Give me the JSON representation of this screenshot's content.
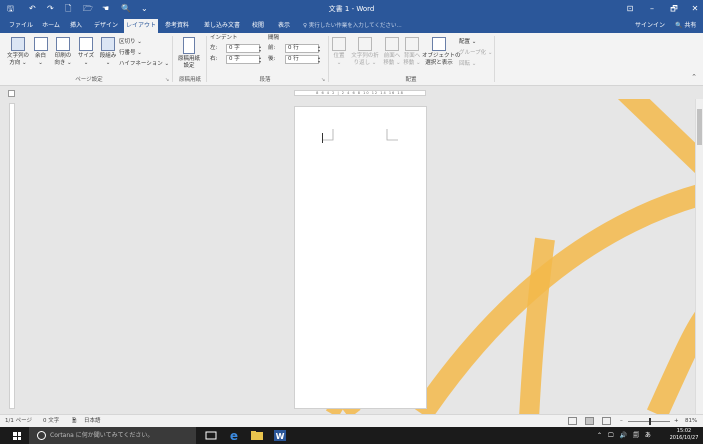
{
  "window": {
    "title": "文書 1 - Word",
    "controls": {
      "ribbon_options": "⊡",
      "minimize": "–",
      "maximize": "🗗",
      "close": "✕"
    }
  },
  "quick_access": {
    "save": "🖫",
    "undo": "↶",
    "redo": "↷",
    "new": "🗋",
    "open": "🗁",
    "touch": "☚",
    "print_preview": "🔍",
    "customize": "⌄"
  },
  "tabs": [
    {
      "label": "ファイル"
    },
    {
      "label": "ホーム"
    },
    {
      "label": "挿入"
    },
    {
      "label": "デザイン"
    },
    {
      "label": "レイアウト",
      "active": true
    },
    {
      "label": "参考資料"
    },
    {
      "label": "差し込み文書"
    },
    {
      "label": "校閲"
    },
    {
      "label": "表示"
    }
  ],
  "tell_me": "♀ 実行したい作業を入力してください...",
  "account": {
    "signin": "サインイン",
    "share": "🔍 共有"
  },
  "ribbon": {
    "page_setup": {
      "label": "ページ設定",
      "text_direction": "文字列の\n方向 ⌄",
      "margins": "余白\n⌄",
      "orientation": "印刷の\n向き ⌄",
      "size": "サイズ\n⌄",
      "columns": "段組み\n⌄",
      "breaks": "区切り ⌄",
      "line_numbers": "行番号 ⌄",
      "hyphenation": "ハイフネーション ⌄"
    },
    "genko": {
      "label": "原稿用紙",
      "button": "原稿用紙\n設定"
    },
    "paragraph": {
      "label": "段落",
      "indent_title": "インデント",
      "spacing_title": "間隔",
      "indent_left_label": "左:",
      "indent_left_value": "0 字",
      "indent_right_label": "右:",
      "indent_right_value": "0 字",
      "space_before_label": "前:",
      "space_before_value": "0 行",
      "space_after_label": "後:",
      "space_after_value": "0 行"
    },
    "arrange": {
      "label": "配置",
      "position": "位置\n⌄",
      "wrap_text": "文字列の折\nり返し ⌄",
      "bring_forward": "前面へ\n移動 ⌄",
      "send_backward": "背面へ\n移動 ⌄",
      "selection_pane": "オブジェクトの\n選択と表示",
      "align": "配置 ⌄",
      "group": "グループ化 ⌄",
      "rotate": "回転 ⌄"
    }
  },
  "ruler": {
    "ticks": "8 6 4 2 | 2 4 6 8 10 12 14 16 18"
  },
  "status": {
    "page": "1/1 ページ",
    "words": "0 文字",
    "language": "日本語",
    "zoom_minus": "–",
    "zoom_plus": "+",
    "zoom": "81%"
  },
  "taskbar": {
    "cortana_placeholder": "Cortana に何か聞いてみてください。",
    "tray": "⌃ 🖵 🔊 🗐 あ",
    "time": "15:02",
    "date": "2016/10/27"
  },
  "colors": {
    "word_blue": "#2b579a",
    "ribbon_bg": "#f3f3f3",
    "canvas_bg": "#e6e6e6",
    "decoration_orange": "#f3b84a",
    "taskbar": "#1b1b1b"
  }
}
